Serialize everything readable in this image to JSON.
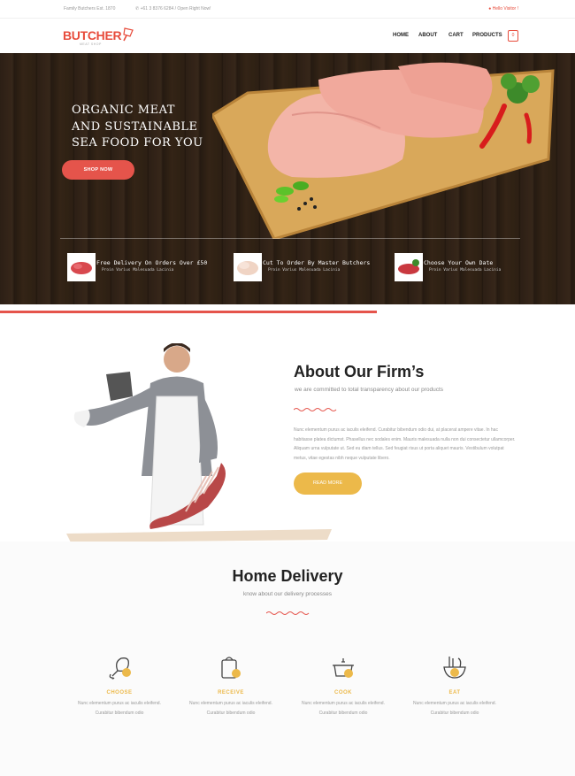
{
  "topbar": {
    "left": "Family Butchers Est. 1870",
    "phone": "+61 3 8376 6284 / Open Right Now!",
    "right": "Hello Visitor !"
  },
  "header": {
    "logo": "BUTCHER",
    "logo_sub": "MEAT SHOP",
    "nav": [
      "HOME",
      "ABOUT",
      "CART",
      "PRODUCTS"
    ],
    "cart_count": "0"
  },
  "hero": {
    "title_lines": [
      "ORGANIC MEAT",
      "AND SUSTAINABLE",
      "SEA FOOD FOR YOU"
    ],
    "button": "SHOP NOW",
    "features": [
      {
        "title": "Free Delivery On Orders Over £50",
        "sub": "Proin Varius Malesuada Lacinia"
      },
      {
        "title": "Cut To Order By Master Butchers",
        "sub": "Proin Varius Malesuada Lacinia"
      },
      {
        "title": "Choose Your Own Date",
        "sub": "Proin Varius Malesuada Lacinia"
      }
    ]
  },
  "about": {
    "title": "About Our Firm’s",
    "subtitle": "we are committed to total transparency about our products",
    "text": "Nunc elementum purus ac iaculis eleifend. Curabitur bibendum odio dui, at placerat ampere vitae. In hac habitasse platea dictumst. Phasellus nec sodales enim. Mauris malesuada nulla non dui consectetur ullamcorper. Aliquam urna vulputate ut. Sed eu diam tellus. Sed feugiat risus ut porta aliquet mauris. Vestibulum volutpat metus, vitae egestas nibh neque vulputate libero.",
    "button": "READ MORE"
  },
  "delivery": {
    "title": "Home Delivery",
    "subtitle": "know about our delivery processes",
    "steps": [
      {
        "label": "CHOOSE",
        "text": "Nunc elementum purus ac iaculis eleifend. Curabitur bibendum odio",
        "icon": "drumstick-icon"
      },
      {
        "label": "RECEIVE",
        "text": "Nunc elementum purus ac iaculis eleifend. Curabitur bibendum odio",
        "icon": "package-icon"
      },
      {
        "label": "COOK",
        "text": "Nunc elementum purus ac iaculis eleifend. Curabitur bibendum odio",
        "icon": "pot-icon"
      },
      {
        "label": "EAT",
        "text": "Nunc elementum purus ac iaculis eleifend. Curabitur bibendum odio",
        "icon": "bowl-icon"
      }
    ]
  },
  "colors": {
    "accent_red": "#e5544b",
    "accent_gold": "#ecb94a"
  }
}
